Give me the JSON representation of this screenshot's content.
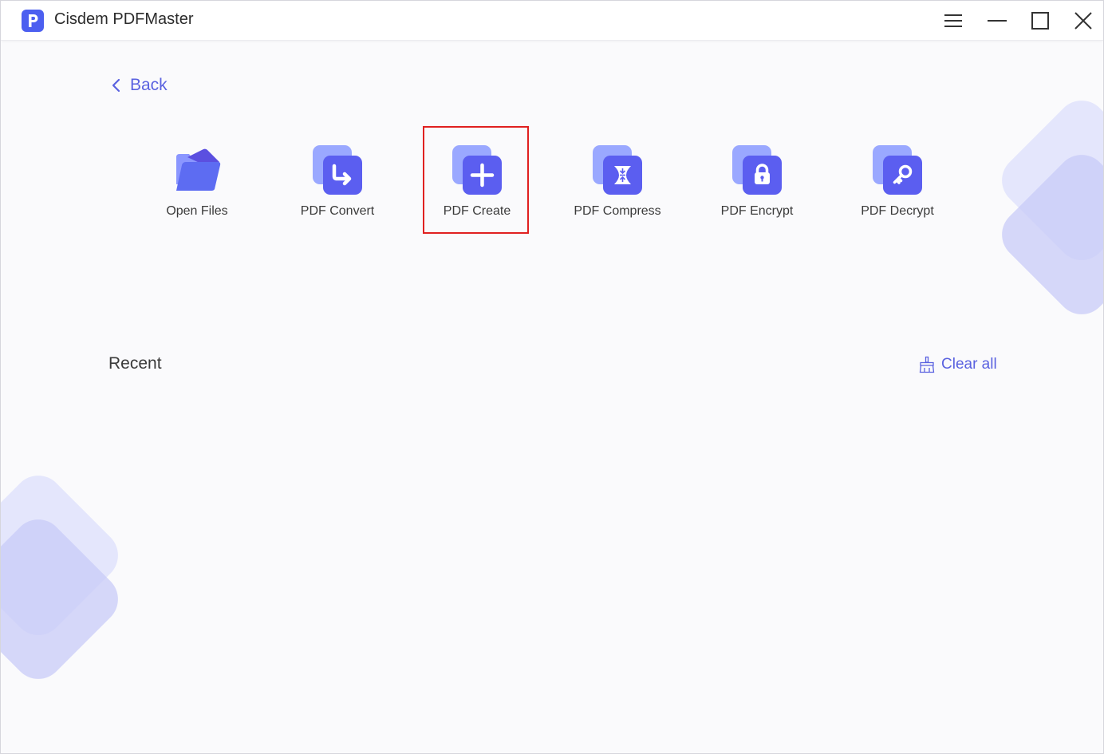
{
  "window": {
    "title": "Cisdem PDFMaster"
  },
  "nav": {
    "back_label": "Back"
  },
  "tools": [
    {
      "id": "open-files",
      "label": "Open Files",
      "icon": "folder-icon"
    },
    {
      "id": "pdf-convert",
      "label": "PDF Convert",
      "icon": "convert-arrow-icon"
    },
    {
      "id": "pdf-create",
      "label": "PDF Create",
      "icon": "plus-icon"
    },
    {
      "id": "pdf-compress",
      "label": "PDF Compress",
      "icon": "compress-icon"
    },
    {
      "id": "pdf-encrypt",
      "label": "PDF Encrypt",
      "icon": "lock-icon"
    },
    {
      "id": "pdf-decrypt",
      "label": "PDF Decrypt",
      "icon": "key-icon"
    }
  ],
  "recent": {
    "title": "Recent",
    "clear_label": "Clear all"
  },
  "colors": {
    "accent": "#5a62e0",
    "icon_back": "#9aa8ff",
    "icon_front": "#5b5ef0",
    "highlight": "#e02020"
  }
}
